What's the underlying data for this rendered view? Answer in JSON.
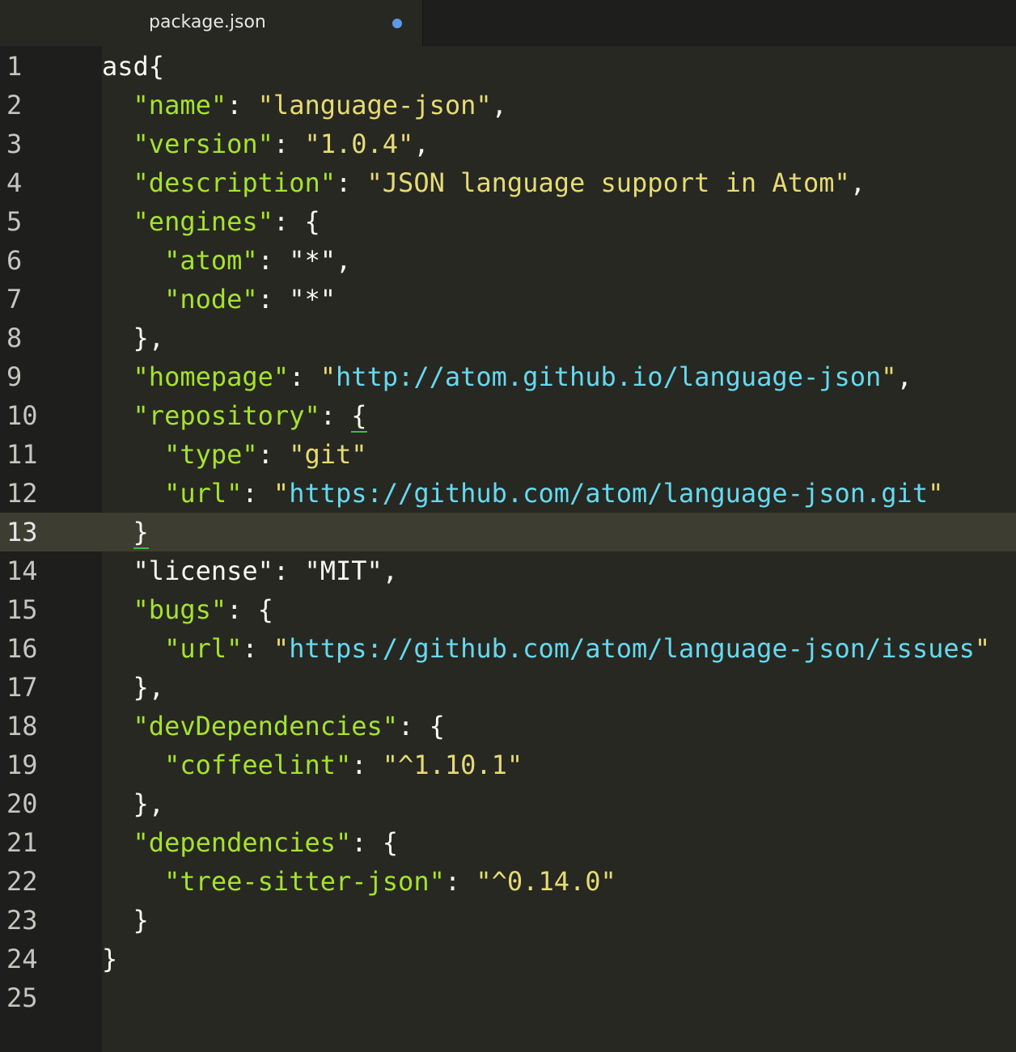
{
  "tab": {
    "title": "package.json",
    "modified": true
  },
  "colors": {
    "background": "#272822",
    "gutter": "#1e1f1c",
    "key": "#a6e22e",
    "string": "#e6db74",
    "url": "#66d9ef",
    "punctuation": "#f8f8f2",
    "modified_dot": "#5a9ae8",
    "bracket_match": "#3cbf3c"
  },
  "editor": {
    "cursor_line": 13,
    "lines": [
      {
        "n": "1",
        "tokens": [
          {
            "t": "asd{",
            "c": "p"
          }
        ]
      },
      {
        "n": "2",
        "tokens": [
          {
            "t": "  ",
            "c": "p"
          },
          {
            "t": "\"name\"",
            "c": "k"
          },
          {
            "t": ": ",
            "c": "p"
          },
          {
            "t": "\"language-json\"",
            "c": "s"
          },
          {
            "t": ",",
            "c": "p"
          }
        ]
      },
      {
        "n": "3",
        "tokens": [
          {
            "t": "  ",
            "c": "p"
          },
          {
            "t": "\"version\"",
            "c": "k"
          },
          {
            "t": ": ",
            "c": "p"
          },
          {
            "t": "\"1.0.4\"",
            "c": "s"
          },
          {
            "t": ",",
            "c": "p"
          }
        ]
      },
      {
        "n": "4",
        "tokens": [
          {
            "t": "  ",
            "c": "p"
          },
          {
            "t": "\"description\"",
            "c": "k"
          },
          {
            "t": ": ",
            "c": "p"
          },
          {
            "t": "\"JSON language support in Atom\"",
            "c": "s"
          },
          {
            "t": ",",
            "c": "p"
          }
        ]
      },
      {
        "n": "5",
        "tokens": [
          {
            "t": "  ",
            "c": "p"
          },
          {
            "t": "\"engines\"",
            "c": "k"
          },
          {
            "t": ": {",
            "c": "p"
          }
        ]
      },
      {
        "n": "6",
        "tokens": [
          {
            "t": "    ",
            "c": "p"
          },
          {
            "t": "\"atom\"",
            "c": "k"
          },
          {
            "t": ": ",
            "c": "p"
          },
          {
            "t": "\"*\"",
            "c": "w"
          },
          {
            "t": ",",
            "c": "p"
          }
        ]
      },
      {
        "n": "7",
        "tokens": [
          {
            "t": "    ",
            "c": "p"
          },
          {
            "t": "\"node\"",
            "c": "k"
          },
          {
            "t": ": ",
            "c": "p"
          },
          {
            "t": "\"*\"",
            "c": "w"
          }
        ]
      },
      {
        "n": "8",
        "tokens": [
          {
            "t": "  },",
            "c": "p"
          }
        ]
      },
      {
        "n": "9",
        "tokens": [
          {
            "t": "  ",
            "c": "p"
          },
          {
            "t": "\"homepage\"",
            "c": "k"
          },
          {
            "t": ": ",
            "c": "p"
          },
          {
            "t": "\"",
            "c": "s"
          },
          {
            "t": "http://atom.github.io/language-json",
            "c": "u"
          },
          {
            "t": "\"",
            "c": "s"
          },
          {
            "t": ",",
            "c": "p"
          }
        ]
      },
      {
        "n": "10",
        "tokens": [
          {
            "t": "  ",
            "c": "p"
          },
          {
            "t": "\"repository\"",
            "c": "k"
          },
          {
            "t": ": ",
            "c": "p"
          },
          {
            "t": "{",
            "c": "p",
            "m": true
          }
        ]
      },
      {
        "n": "11",
        "tokens": [
          {
            "t": "    ",
            "c": "p"
          },
          {
            "t": "\"type\"",
            "c": "k"
          },
          {
            "t": ": ",
            "c": "p"
          },
          {
            "t": "\"git\"",
            "c": "s"
          }
        ]
      },
      {
        "n": "12",
        "tokens": [
          {
            "t": "    ",
            "c": "p"
          },
          {
            "t": "\"url\"",
            "c": "k"
          },
          {
            "t": ": ",
            "c": "p"
          },
          {
            "t": "\"",
            "c": "s"
          },
          {
            "t": "https://github.com/atom/language-json.git",
            "c": "u"
          },
          {
            "t": "\"",
            "c": "s"
          }
        ]
      },
      {
        "n": "13",
        "tokens": [
          {
            "t": "  ",
            "c": "p"
          },
          {
            "t": "}",
            "c": "p",
            "m": true
          }
        ]
      },
      {
        "n": "14",
        "tokens": [
          {
            "t": "  \"license\": \"MIT\",",
            "c": "w"
          }
        ]
      },
      {
        "n": "15",
        "tokens": [
          {
            "t": "  ",
            "c": "p"
          },
          {
            "t": "\"bugs\"",
            "c": "k"
          },
          {
            "t": ": {",
            "c": "p"
          }
        ]
      },
      {
        "n": "16",
        "tokens": [
          {
            "t": "    ",
            "c": "p"
          },
          {
            "t": "\"url\"",
            "c": "k"
          },
          {
            "t": ": ",
            "c": "p"
          },
          {
            "t": "\"",
            "c": "s"
          },
          {
            "t": "https://github.com/atom/language-json/issues",
            "c": "u"
          },
          {
            "t": "\"",
            "c": "s"
          }
        ]
      },
      {
        "n": "17",
        "tokens": [
          {
            "t": "  },",
            "c": "p"
          }
        ]
      },
      {
        "n": "18",
        "tokens": [
          {
            "t": "  ",
            "c": "p"
          },
          {
            "t": "\"devDependencies\"",
            "c": "k"
          },
          {
            "t": ": {",
            "c": "p"
          }
        ]
      },
      {
        "n": "19",
        "tokens": [
          {
            "t": "    ",
            "c": "p"
          },
          {
            "t": "\"coffeelint\"",
            "c": "k"
          },
          {
            "t": ": ",
            "c": "p"
          },
          {
            "t": "\"^1.10.1\"",
            "c": "s"
          }
        ]
      },
      {
        "n": "20",
        "tokens": [
          {
            "t": "  },",
            "c": "p"
          }
        ]
      },
      {
        "n": "21",
        "tokens": [
          {
            "t": "  ",
            "c": "p"
          },
          {
            "t": "\"dependencies\"",
            "c": "k"
          },
          {
            "t": ": {",
            "c": "p"
          }
        ]
      },
      {
        "n": "22",
        "tokens": [
          {
            "t": "    ",
            "c": "p"
          },
          {
            "t": "\"tree-sitter-json\"",
            "c": "k"
          },
          {
            "t": ": ",
            "c": "p"
          },
          {
            "t": "\"^0.14.0\"",
            "c": "s"
          }
        ]
      },
      {
        "n": "23",
        "tokens": [
          {
            "t": "  }",
            "c": "p"
          }
        ]
      },
      {
        "n": "24",
        "tokens": [
          {
            "t": "}",
            "c": "p"
          }
        ]
      },
      {
        "n": "25",
        "tokens": []
      }
    ]
  }
}
